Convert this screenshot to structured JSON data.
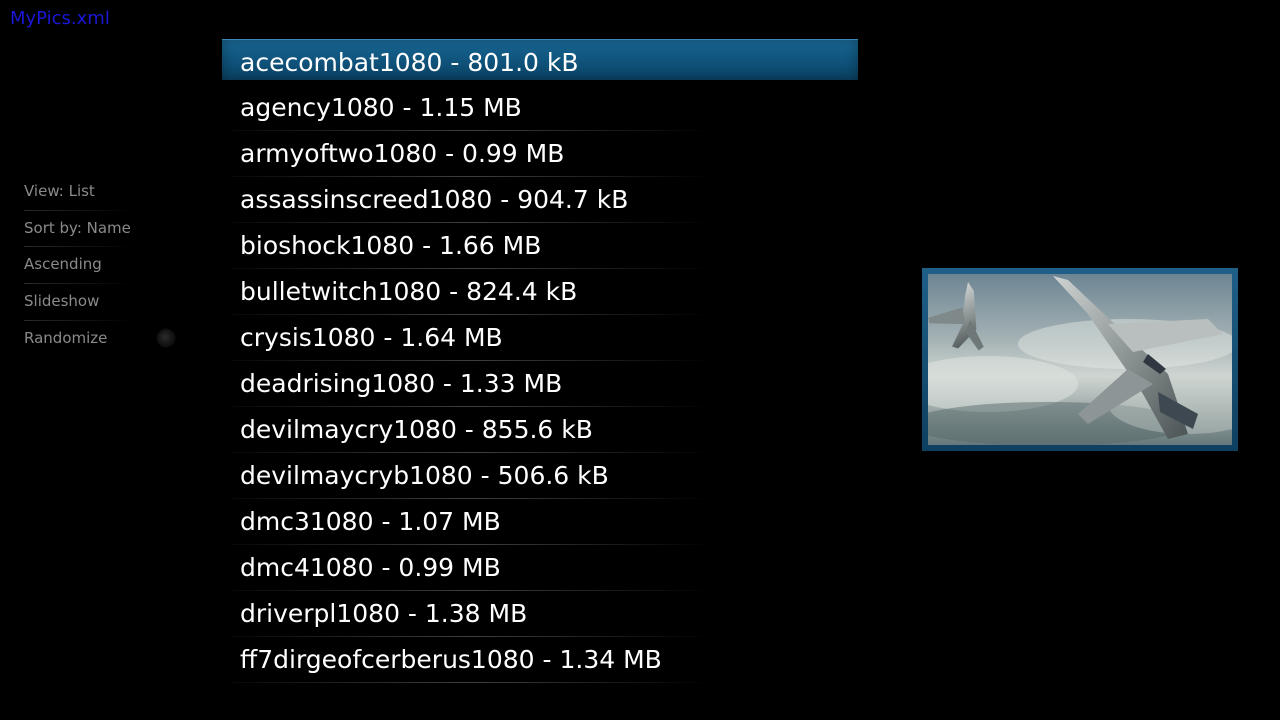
{
  "window": {
    "title": "MyPics.xml"
  },
  "side_menu": {
    "items": [
      {
        "label": "View: List"
      },
      {
        "label": "Sort by: Name"
      },
      {
        "label": "Ascending"
      },
      {
        "label": "Slideshow"
      },
      {
        "label": "Randomize",
        "toggle": "off"
      }
    ]
  },
  "file_list": {
    "selected_index": 0,
    "items": [
      {
        "label": "acecombat1080 - 801.0 kB"
      },
      {
        "label": "agency1080 - 1.15 MB"
      },
      {
        "label": "armyoftwo1080 - 0.99 MB"
      },
      {
        "label": "assassinscreed1080 - 904.7 kB"
      },
      {
        "label": "bioshock1080 - 1.66 MB"
      },
      {
        "label": "bulletwitch1080 - 824.4 kB"
      },
      {
        "label": "crysis1080 - 1.64 MB"
      },
      {
        "label": "deadrising1080 - 1.33 MB"
      },
      {
        "label": "devilmaycry1080 - 855.6 kB"
      },
      {
        "label": "devilmaycryb1080 - 506.6 kB"
      },
      {
        "label": "dmc31080 - 1.07 MB"
      },
      {
        "label": "dmc41080 - 0.99 MB"
      },
      {
        "label": "driverpl1080 - 1.38 MB"
      },
      {
        "label": "ff7dirgeofcerberus1080 - 1.34 MB"
      }
    ]
  },
  "preview": {
    "icon": "fighter-jets-thumbnail"
  },
  "colors": {
    "selection": "#10567f",
    "title": "#1a17d6",
    "menu_text": "#8a8a8a"
  }
}
